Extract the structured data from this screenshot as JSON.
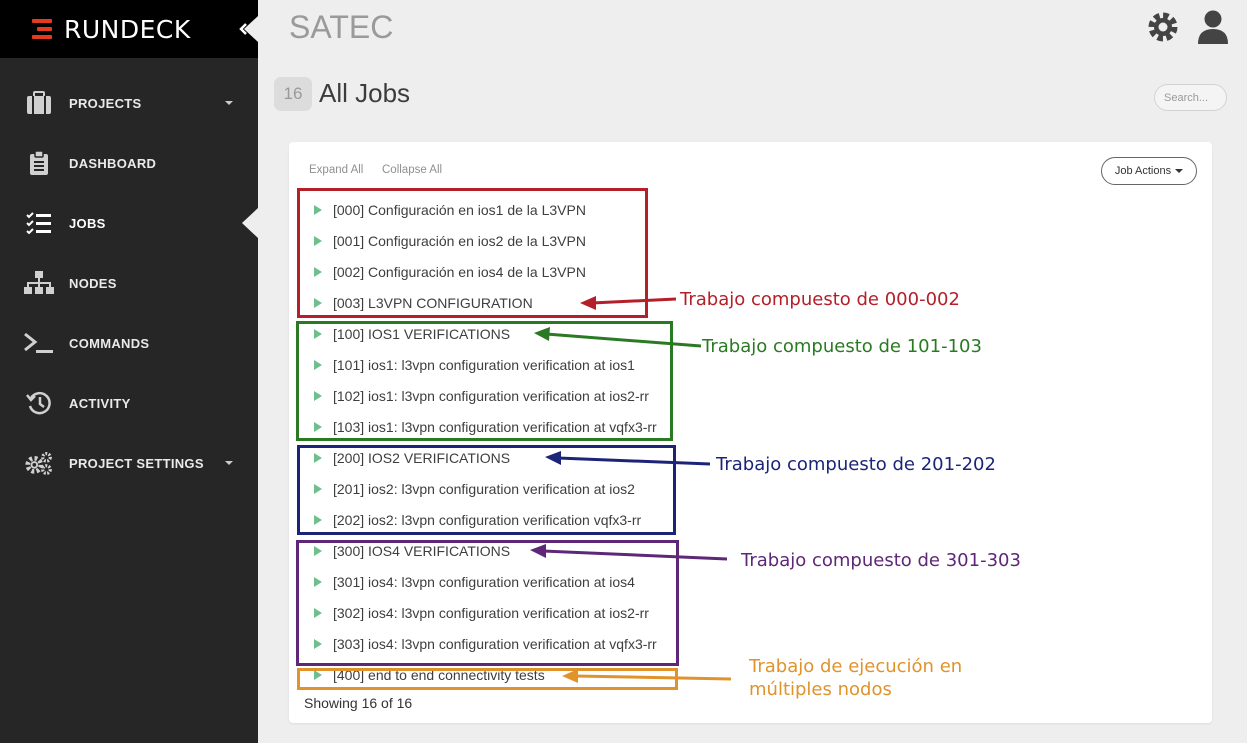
{
  "brand": {
    "name": "RUNDECK",
    "accent": "#e63a1e"
  },
  "sidebar": {
    "items": [
      {
        "label": "PROJECTS",
        "icon": "briefcase-icon",
        "dropdown": true
      },
      {
        "label": "DASHBOARD",
        "icon": "clipboard-icon",
        "dropdown": false
      },
      {
        "label": "JOBS",
        "icon": "checklist-icon",
        "dropdown": false,
        "active": true
      },
      {
        "label": "NODES",
        "icon": "sitemap-icon",
        "dropdown": false
      },
      {
        "label": "COMMANDS",
        "icon": "terminal-icon",
        "dropdown": false
      },
      {
        "label": "ACTIVITY",
        "icon": "history-icon",
        "dropdown": false
      },
      {
        "label": "PROJECT SETTINGS",
        "icon": "cogs-icon",
        "dropdown": true
      }
    ]
  },
  "header": {
    "project": "SATEC"
  },
  "page": {
    "count": "16",
    "title": "All Jobs",
    "search_placeholder": "Search..."
  },
  "card": {
    "expand_all": "Expand All",
    "collapse_all": "Collapse All",
    "job_actions": "Job Actions",
    "showing": "Showing 16 of 16"
  },
  "jobs": [
    "[000] Configuración en ios1 de la L3VPN",
    "[001] Configuración en ios2 de la L3VPN",
    "[002] Configuración en ios4 de la L3VPN",
    "[003] L3VPN CONFIGURATION",
    "[100] IOS1 VERIFICATIONS",
    "[101] ios1: l3vpn configuration verification at ios1",
    "[102] ios1: l3vpn configuration verification at ios2-rr",
    "[103] ios1: l3vpn configuration verification at vqfx3-rr",
    "[200] IOS2 VERIFICATIONS",
    "[201] ios2: l3vpn configuration verification at ios2",
    "[202] ios2: l3vpn configuration verification vqfx3-rr",
    "[300] IOS4 VERIFICATIONS",
    "[301] ios4: l3vpn configuration verification at ios4",
    "[302] ios4: l3vpn configuration verification at ios2-rr",
    "[303] ios4: l3vpn configuration verification at vqfx3-rr",
    "[400] end to end connectivity tests"
  ],
  "annotations": [
    {
      "text": "Trabajo compuesto de 000-002",
      "color": "#b3202a"
    },
    {
      "text": "Trabajo compuesto de 101-103",
      "color": "#2a7a23"
    },
    {
      "text": "Trabajo compuesto de 201-202",
      "color": "#1c2478"
    },
    {
      "text": "Trabajo compuesto de 301-303",
      "color": "#5e2777"
    },
    {
      "text_line1": "Trabajo de ejecución en",
      "text_line2": "múltiples nodos",
      "color": "#e0932a"
    }
  ]
}
